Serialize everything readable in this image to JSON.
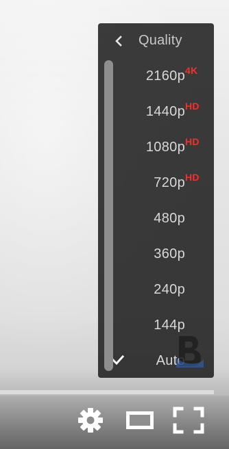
{
  "quality_menu": {
    "title": "Quality",
    "back_icon": "chevron-left-icon",
    "items": [
      {
        "label": "2160p",
        "badge": "4K",
        "selected": false
      },
      {
        "label": "1440p",
        "badge": "HD",
        "selected": false
      },
      {
        "label": "1080p",
        "badge": "HD",
        "selected": false
      },
      {
        "label": "720p",
        "badge": "HD",
        "selected": false
      },
      {
        "label": "480p",
        "badge": "",
        "selected": false
      },
      {
        "label": "360p",
        "badge": "",
        "selected": false
      },
      {
        "label": "240p",
        "badge": "",
        "selected": false
      },
      {
        "label": "144p",
        "badge": "",
        "selected": false
      },
      {
        "label": "Auto",
        "badge": "",
        "selected": true
      }
    ],
    "check_icon": "checkmark-icon"
  },
  "controls": {
    "settings_icon": "gear-icon",
    "theater_icon": "theater-mode-icon",
    "fullscreen_icon": "fullscreen-icon"
  },
  "colors": {
    "badge": "#ff2a2a",
    "menu_bg": "#1c1c1c",
    "text": "#d8d8d8"
  }
}
